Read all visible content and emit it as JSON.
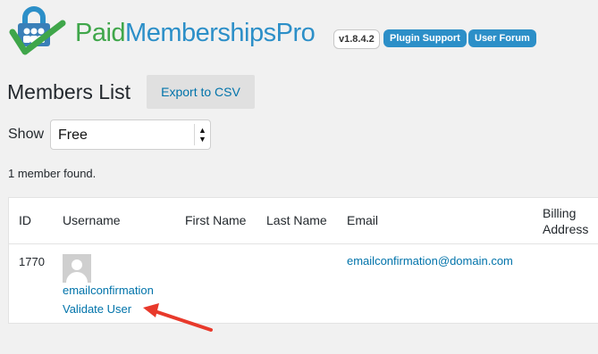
{
  "header": {
    "brand_part1": "Paid",
    "brand_part2": "Memberships",
    "brand_part3": "Pro",
    "version": "v1.8.4.2",
    "plugin_support": "Plugin Support",
    "user_forum": "User Forum"
  },
  "page": {
    "title": "Members List",
    "export_label": "Export to CSV"
  },
  "filter": {
    "show_label": "Show",
    "selected_level": "Free"
  },
  "results": {
    "count_text": "1 member found."
  },
  "table": {
    "columns": {
      "id": "ID",
      "username": "Username",
      "first_name": "First Name",
      "last_name": "Last Name",
      "email": "Email",
      "billing_line1": "Billing",
      "billing_line2": "Address"
    },
    "rows": [
      {
        "id": "1770",
        "username": "emailconfirmation",
        "action": "Validate User",
        "first_name": "",
        "last_name": "",
        "email": "emailconfirmation@domain.com"
      }
    ]
  },
  "colors": {
    "brand_green": "#3fa64a",
    "brand_blue": "#2c8fc8",
    "link_blue": "#0073aa",
    "annotation_arrow": "#e8392b"
  }
}
